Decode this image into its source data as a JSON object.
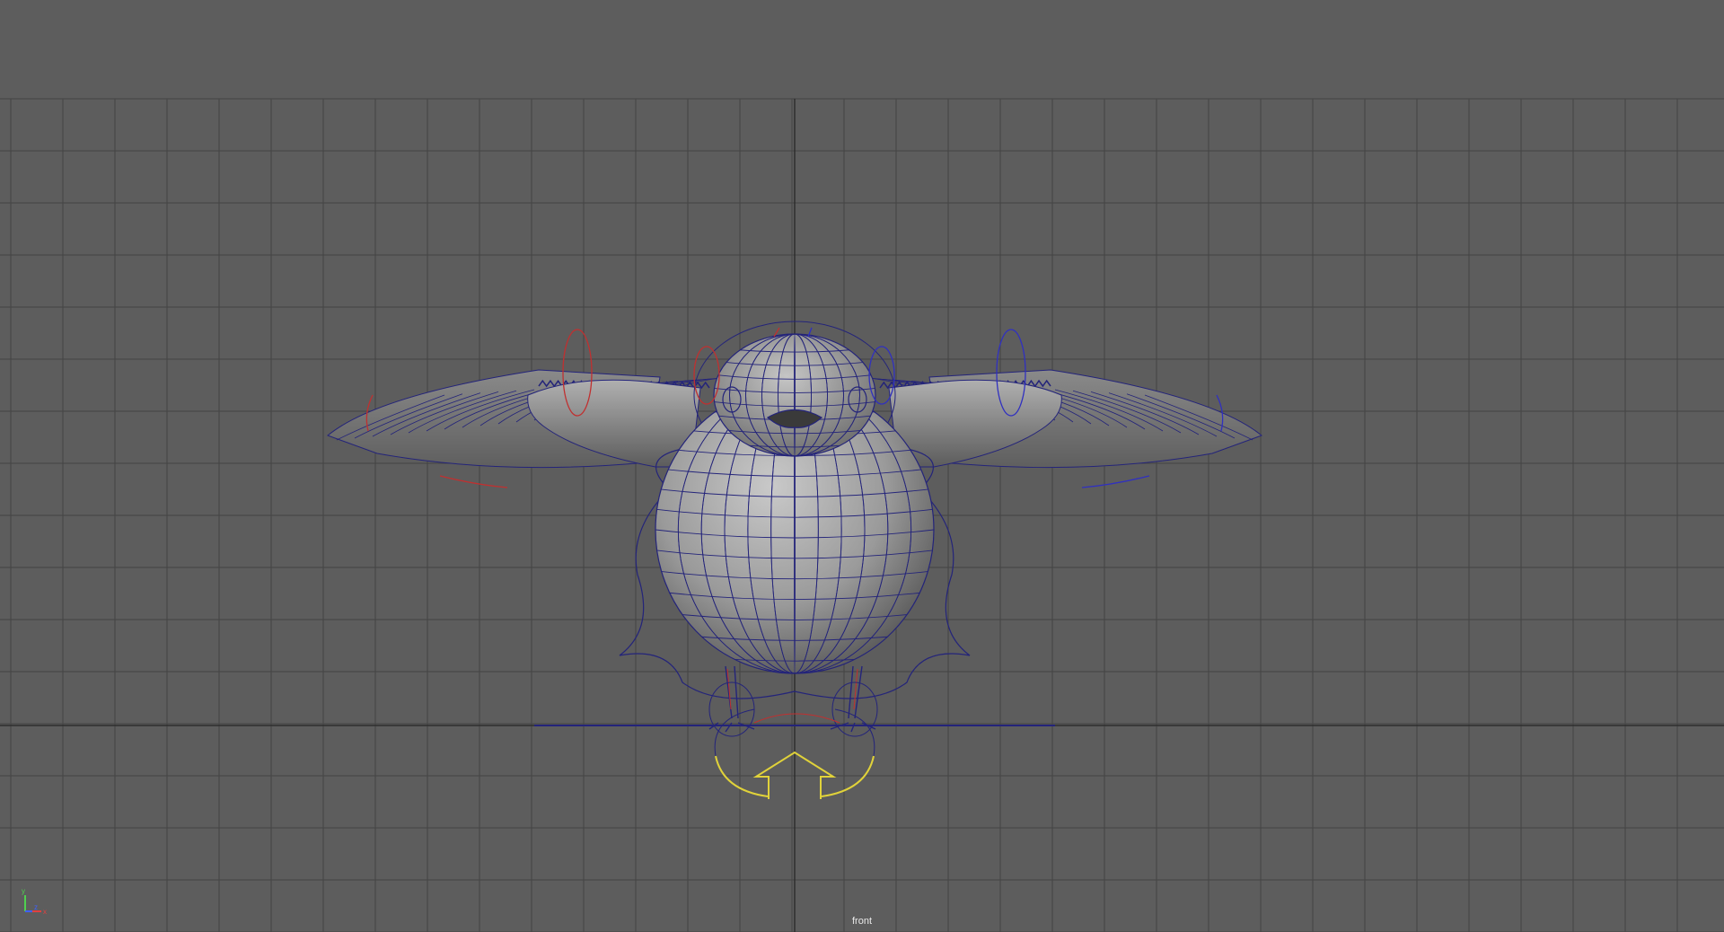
{
  "viewport": {
    "camera_label": "front",
    "background_color": "#5d5d5d",
    "grid_color": "#444444",
    "grid_axis_color": "#2e2e2e",
    "wireframe_color": "#24247a",
    "left_control_color": "#c03030",
    "right_control_color": "#3030c0",
    "root_control_color": "#e0d23a"
  },
  "icons": {
    "axis_gizmo": "axis-gizmo-icon"
  }
}
